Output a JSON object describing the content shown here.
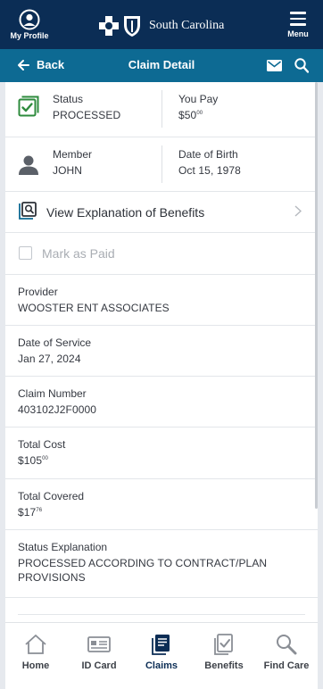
{
  "header": {
    "profile_label": "My Profile",
    "brand_name": "South Carolina",
    "menu_label": "Menu"
  },
  "nav": {
    "back_label": "Back",
    "title": "Claim Detail"
  },
  "status_row": {
    "status_label": "Status",
    "status_value": "PROCESSED",
    "you_pay_label": "You Pay",
    "you_pay_dollars": "$50",
    "you_pay_cents": "00"
  },
  "member_row": {
    "member_label": "Member",
    "member_value": "JOHN",
    "dob_label": "Date of Birth",
    "dob_value": "Oct 15, 1978"
  },
  "eob": {
    "label": "View Explanation of Benefits"
  },
  "mark_paid": {
    "label": "Mark as Paid",
    "checked": false
  },
  "details": {
    "provider_label": "Provider",
    "provider_value": "WOOSTER ENT ASSOCIATES",
    "dos_label": "Date of Service",
    "dos_value": "Jan 27, 2024",
    "claim_number_label": "Claim Number",
    "claim_number_value": "403102J2F0000",
    "total_cost_label": "Total Cost",
    "total_cost_dollars": "$105",
    "total_cost_cents": "00",
    "total_covered_label": "Total Covered",
    "total_covered_dollars": "$17",
    "total_covered_cents": "76",
    "status_expl_label": "Status Explanation",
    "status_expl_line1": "PROCESSED ACCORDING TO CONTRACT/PLAN",
    "status_expl_line2": "PROVISIONS"
  },
  "tabs": [
    {
      "label": "Home",
      "icon": "home-icon"
    },
    {
      "label": "ID Card",
      "icon": "id-card-icon"
    },
    {
      "label": "Claims",
      "icon": "claims-icon"
    },
    {
      "label": "Benefits",
      "icon": "benefits-icon"
    },
    {
      "label": "Find Care",
      "icon": "find-care-icon"
    }
  ],
  "colors": {
    "header_bg": "#0b2d55",
    "navbar_bg": "#0d6a93",
    "status_icon_green": "#2e8b3d",
    "page_bg": "#e6e9ee"
  }
}
